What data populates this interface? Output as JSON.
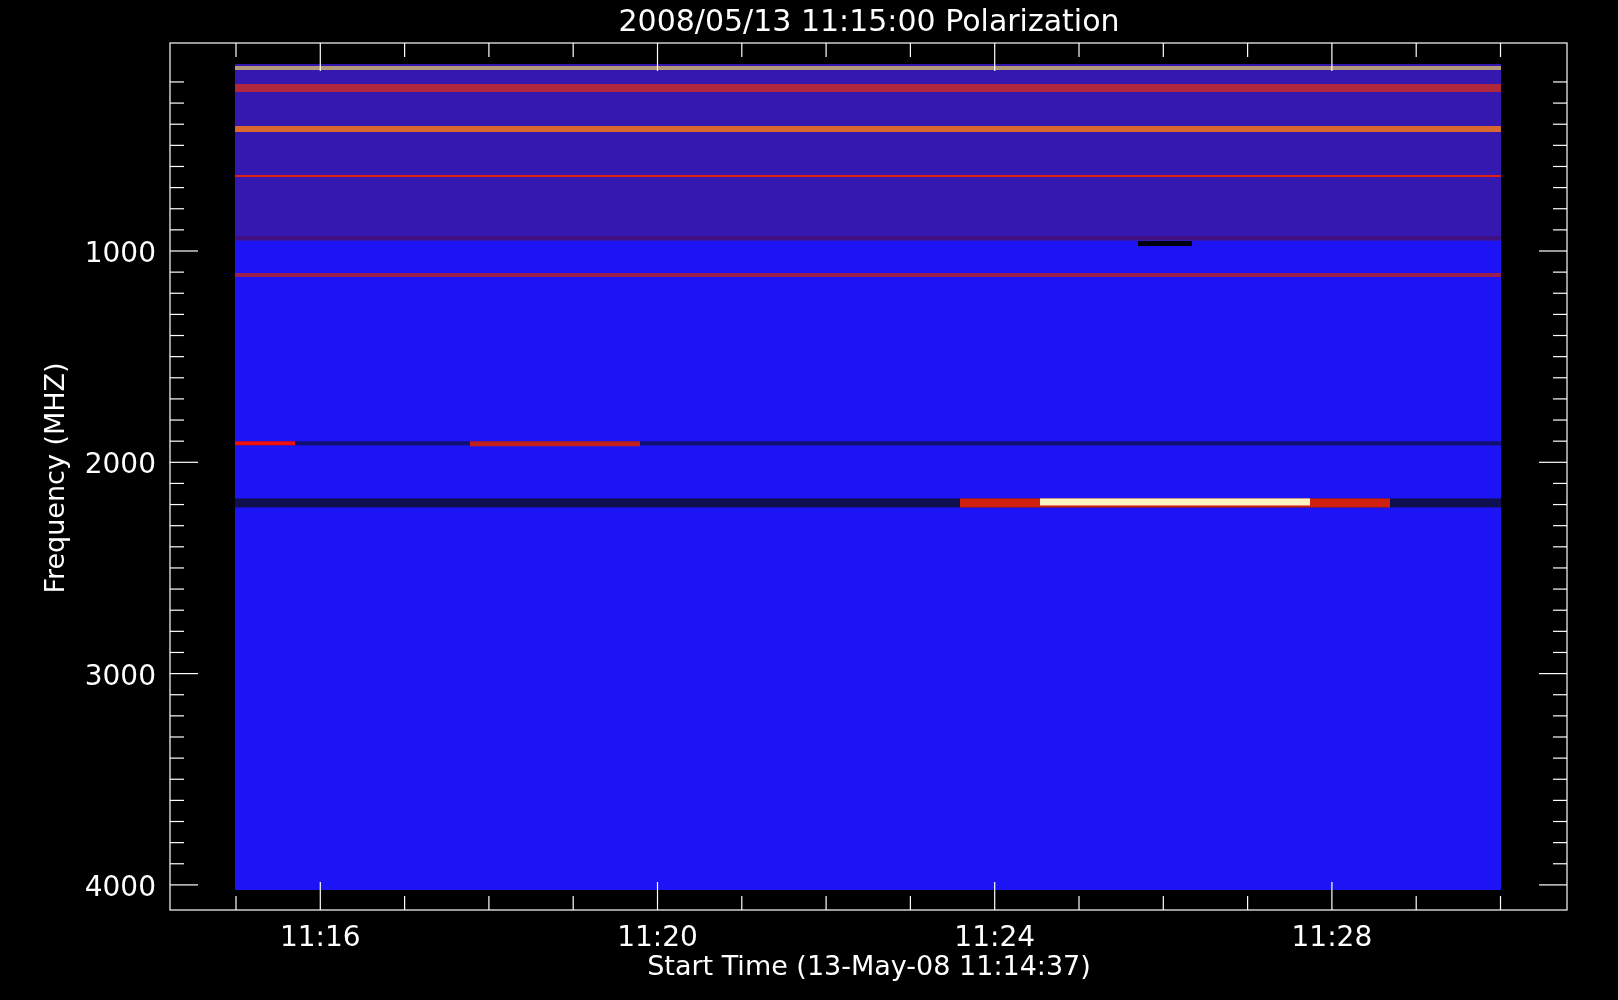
{
  "title": "2008/05/13 11:15:00 Polarization",
  "y_axis": {
    "label": "Frequency (MHZ)",
    "ticks": [
      "1000",
      "2000",
      "3000",
      "4000"
    ]
  },
  "x_axis": {
    "label": "Start Time (13-May-08 11:14:37)",
    "ticks": [
      "11:16",
      "11:20",
      "11:24",
      "11:28"
    ]
  }
}
